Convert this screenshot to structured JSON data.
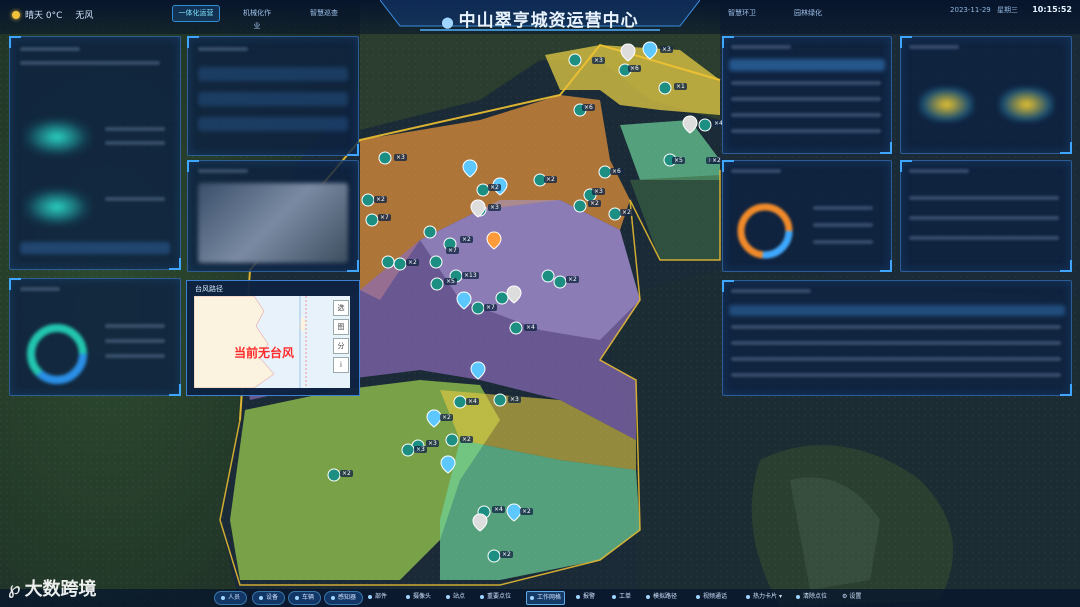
{
  "header": {
    "weather_text": "晴天 0°C",
    "wind_text": "无风",
    "tabs": [
      {
        "label": "一体化运营"
      },
      {
        "label": "机械化作业"
      },
      {
        "label": "智慧巡查"
      },
      {
        "label": "智慧环卫"
      },
      {
        "label": "园林绿化"
      }
    ],
    "title": "中山翠亨城资运营中心",
    "date": "2023-11-29",
    "weekday": "星期三",
    "time": "10:15:52"
  },
  "typhoon": {
    "title": "台风路径",
    "message": "当前无台风",
    "tools": [
      "选",
      "图",
      "分",
      "i"
    ]
  },
  "bottom_bar": {
    "buttons": [
      "人员",
      "设备",
      "车辆",
      "感知器"
    ],
    "items": [
      {
        "label": "部件",
        "active": false
      },
      {
        "label": "摄像头",
        "active": false
      },
      {
        "label": "站点",
        "active": false
      },
      {
        "label": "重要点位",
        "active": false
      },
      {
        "label": "工作网格",
        "active": true
      },
      {
        "label": "报警",
        "active": false
      },
      {
        "label": "工单",
        "active": false
      },
      {
        "label": "模拟路径",
        "active": false
      },
      {
        "label": "视频通话",
        "active": false
      },
      {
        "label": "热力卡片",
        "active": false
      },
      {
        "label": "清除点位",
        "active": false
      },
      {
        "label": "设置",
        "active": false
      }
    ]
  },
  "map_badges": [
    "×3",
    "×6",
    "×6",
    "×3",
    "×1",
    "×2",
    "×4",
    "×5",
    "×2",
    "×3",
    "×2",
    "×2",
    "×3",
    "×2",
    "×7",
    "×2",
    "×3",
    "×2",
    "×7",
    "×2",
    "×13",
    "×5",
    "×2",
    "×4",
    "×7",
    "×3",
    "×4",
    "×3",
    "×2",
    "×2",
    "×3",
    "×2",
    "×4",
    "×2",
    "×2",
    "×2",
    "×6"
  ],
  "watermark": {
    "text": "大数跨境"
  },
  "colors": {
    "accent": "#3ea6ff",
    "alert": "#ff2a2a",
    "zone_orange": "#d98b3a",
    "zone_purple": "#8a6bb8",
    "zone_green": "#9ac94e",
    "zone_mint": "#6fd39a",
    "zone_yellow": "#e6cc45"
  }
}
